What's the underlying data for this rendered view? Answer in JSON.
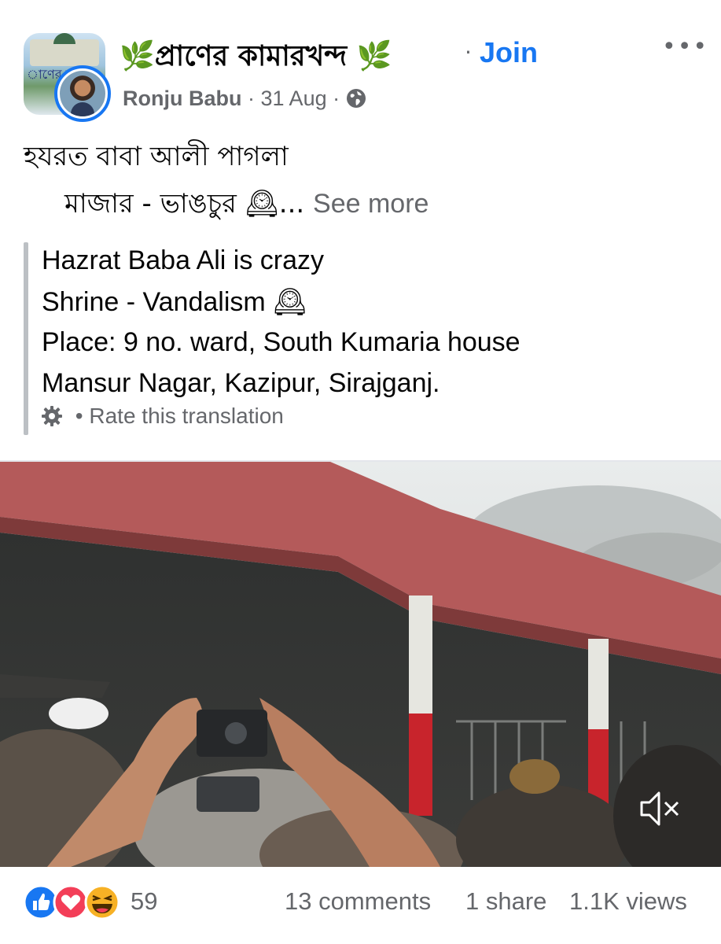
{
  "post": {
    "group": {
      "leaf_emoji": "🌿",
      "name": "প্রাণের কামারখন্দ",
      "avatar_text": "াণের কাম",
      "separator": "·",
      "join_label": "Join",
      "more_label": "•••"
    },
    "author": "Ronju Babu",
    "date": "31 Aug",
    "meta_separator": "·",
    "visibility_icon": "globe-icon",
    "text": {
      "line1": "হযরত বাবা আলী পাগলা",
      "line2": "মাজার  - ভাঙচুর",
      "clock_emoji": "🕰",
      "ellipsis": "...",
      "see_more": "See more"
    },
    "translation": {
      "lines": [
        "Hazrat Baba Ali is crazy",
        "Shrine - Vandalism",
        "Place: 9 no. ward, South Kumaria house",
        "Mansur Nagar, Kazipur, Sirajganj."
      ],
      "clock_emoji": "🕰",
      "settings_icon": "gear-icon",
      "bullet": "•",
      "rate_label": "Rate this translation"
    },
    "video": {
      "muted_icon": "speaker-muted-icon"
    },
    "footer": {
      "reaction_icons": [
        "like-icon",
        "love-icon",
        "haha-icon"
      ],
      "reaction_count": "59",
      "comments": "13 comments",
      "shares": "1 share",
      "views": "1.1K views"
    },
    "colors": {
      "accent": "#1877f2",
      "secondary_text": "#65676b",
      "primary_text": "#050505",
      "love": "#f33e58",
      "haha": "#f7b125"
    }
  }
}
